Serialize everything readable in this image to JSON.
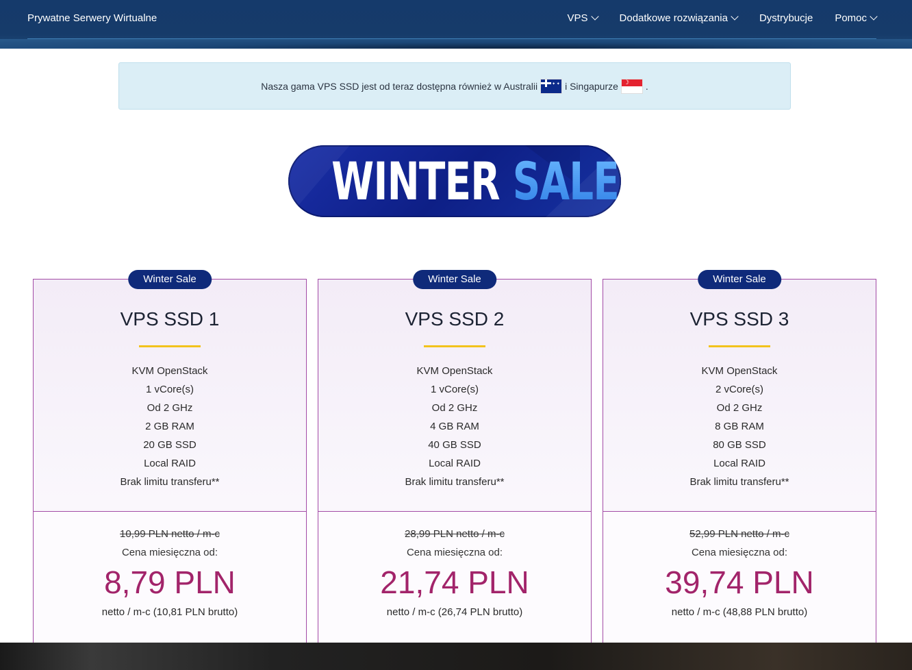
{
  "header": {
    "brand": "Prywatne Serwery Wirtualne",
    "nav": [
      {
        "label": "VPS",
        "has_dropdown": true
      },
      {
        "label": "Dodatkowe rozwiązania",
        "has_dropdown": true
      },
      {
        "label": "Dystrybucje",
        "has_dropdown": false
      },
      {
        "label": "Pomoc",
        "has_dropdown": true
      }
    ]
  },
  "notice": {
    "text_before": "Nasza gama VPS SSD jest od teraz dostępna również w Australii",
    "text_middle": "i Singapurze",
    "text_after": ".",
    "flags": [
      "australia-flag-icon",
      "singapore-flag-icon"
    ]
  },
  "banner": {
    "word1": "WINTER",
    "word2": "SALE"
  },
  "plans": [
    {
      "badge": "Winter Sale",
      "title": "VPS SSD 1",
      "features": [
        "KVM OpenStack",
        "1 vCore(s)",
        "Od 2 GHz",
        "2 GB RAM",
        "20 GB SSD",
        "Local RAID",
        "Brak limitu transferu**"
      ],
      "old_price": "10,99 PLN netto / m-c",
      "from_label": "Cena miesięczna od:",
      "price": "8,79 PLN",
      "net_note": "netto / m-c (10,81 PLN brutto)"
    },
    {
      "badge": "Winter Sale",
      "title": "VPS SSD 2",
      "features": [
        "KVM OpenStack",
        "1 vCore(s)",
        "Od 2 GHz",
        "4 GB RAM",
        "40 GB SSD",
        "Local RAID",
        "Brak limitu transferu**"
      ],
      "old_price": "28,99 PLN netto / m-c",
      "from_label": "Cena miesięczna od:",
      "price": "21,74 PLN",
      "net_note": "netto / m-c (26,74 PLN brutto)"
    },
    {
      "badge": "Winter Sale",
      "title": "VPS SSD 3",
      "features": [
        "KVM OpenStack",
        "2 vCore(s)",
        "Od 2 GHz",
        "8 GB RAM",
        "80 GB SSD",
        "Local RAID",
        "Brak limitu transferu**"
      ],
      "old_price": "52,99 PLN netto / m-c",
      "from_label": "Cena miesięczna od:",
      "price": "39,74 PLN",
      "net_note": "netto / m-c (48,88 PLN brutto)"
    }
  ],
  "colors": {
    "header_bg": "#153a6b",
    "badge_bg": "#0f2a7a",
    "card_border": "#a24aa6",
    "price": "#a2246a",
    "accent": "#f2c31c"
  }
}
